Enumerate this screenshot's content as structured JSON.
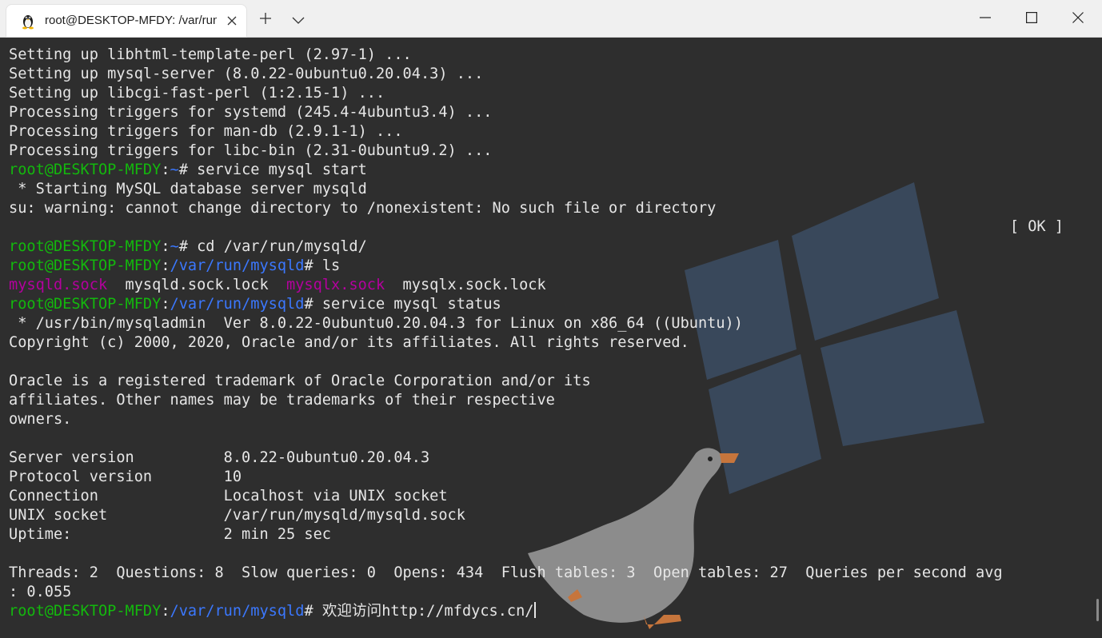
{
  "window": {
    "tab_title": "root@DESKTOP-MFDY: /var/run",
    "tab_icon": "linux-penguin-icon",
    "new_tab_icon": "plus-icon",
    "dropdown_icon": "chevron-down-icon",
    "minimize_icon": "minimize-icon",
    "maximize_icon": "maximize-icon",
    "close_icon": "close-icon"
  },
  "colors": {
    "prompt_user": "#13b80d",
    "prompt_path": "#3b78ff",
    "socket_file": "#b4009e",
    "text": "#e6e6e6",
    "background": "#2e2e2e"
  },
  "terminal": {
    "lines": [
      [
        {
          "t": "Setting up libhtml-template-perl (2.97-1) ...",
          "c": "w"
        }
      ],
      [
        {
          "t": "Setting up mysql-server (8.0.22-0ubuntu0.20.04.3) ...",
          "c": "w"
        }
      ],
      [
        {
          "t": "Setting up libcgi-fast-perl (1:2.15-1) ...",
          "c": "w"
        }
      ],
      [
        {
          "t": "Processing triggers for systemd (245.4-4ubuntu3.4) ...",
          "c": "w"
        }
      ],
      [
        {
          "t": "Processing triggers for man-db (2.9.1-1) ...",
          "c": "w"
        }
      ],
      [
        {
          "t": "Processing triggers for libc-bin (2.31-0ubuntu9.2) ...",
          "c": "w"
        }
      ],
      [
        {
          "t": "root@DESKTOP-MFDY",
          "c": "g"
        },
        {
          "t": ":",
          "c": "w"
        },
        {
          "t": "~",
          "c": "b"
        },
        {
          "t": "# service mysql start",
          "c": "w"
        }
      ],
      [
        {
          "t": " * Starting MySQL database server mysqld",
          "c": "w"
        }
      ],
      [
        {
          "t": "su: warning: cannot change directory to /nonexistent: No such file or directory",
          "c": "w"
        }
      ],
      [
        {
          "t": "",
          "c": "w"
        }
      ],
      [
        {
          "t": "root@DESKTOP-MFDY",
          "c": "g"
        },
        {
          "t": ":",
          "c": "w"
        },
        {
          "t": "~",
          "c": "b"
        },
        {
          "t": "# cd /var/run/mysqld/",
          "c": "w"
        }
      ],
      [
        {
          "t": "root@DESKTOP-MFDY",
          "c": "g"
        },
        {
          "t": ":",
          "c": "w"
        },
        {
          "t": "/var/run/mysqld",
          "c": "b"
        },
        {
          "t": "# ls",
          "c": "w"
        }
      ],
      [
        {
          "t": "mysqld.sock",
          "c": "m"
        },
        {
          "t": "  mysqld.sock.lock  ",
          "c": "w"
        },
        {
          "t": "mysqlx.sock",
          "c": "m"
        },
        {
          "t": "  mysqlx.sock.lock",
          "c": "w"
        }
      ],
      [
        {
          "t": "root@DESKTOP-MFDY",
          "c": "g"
        },
        {
          "t": ":",
          "c": "w"
        },
        {
          "t": "/var/run/mysqld",
          "c": "b"
        },
        {
          "t": "# service mysql status",
          "c": "w"
        }
      ],
      [
        {
          "t": " * /usr/bin/mysqladmin  Ver 8.0.22-0ubuntu0.20.04.3 for Linux on x86_64 ((Ubuntu))",
          "c": "w"
        }
      ],
      [
        {
          "t": "Copyright (c) 2000, 2020, Oracle and/or its affiliates. All rights reserved.",
          "c": "w"
        }
      ],
      [
        {
          "t": "",
          "c": "w"
        }
      ],
      [
        {
          "t": "Oracle is a registered trademark of Oracle Corporation and/or its",
          "c": "w"
        }
      ],
      [
        {
          "t": "affiliates. Other names may be trademarks of their respective",
          "c": "w"
        }
      ],
      [
        {
          "t": "owners.",
          "c": "w"
        }
      ],
      [
        {
          "t": "",
          "c": "w"
        }
      ],
      [
        {
          "t": "Server version          8.0.22-0ubuntu0.20.04.3",
          "c": "w"
        }
      ],
      [
        {
          "t": "Protocol version        10",
          "c": "w"
        }
      ],
      [
        {
          "t": "Connection              Localhost via UNIX socket",
          "c": "w"
        }
      ],
      [
        {
          "t": "UNIX socket             /var/run/mysqld/mysqld.sock",
          "c": "w"
        }
      ],
      [
        {
          "t": "Uptime:                 2 min 25 sec",
          "c": "w"
        }
      ],
      [
        {
          "t": "",
          "c": "w"
        }
      ],
      [
        {
          "t": "Threads: 2  Questions: 8  Slow queries: 0  Opens: 434  Flush tables: 3  Open tables: 27  Queries per second avg",
          "c": "w"
        }
      ],
      [
        {
          "t": ": 0.055",
          "c": "w"
        }
      ],
      [
        {
          "t": "root@DESKTOP-MFDY",
          "c": "g"
        },
        {
          "t": ":",
          "c": "w"
        },
        {
          "t": "/var/run/mysqld",
          "c": "b"
        },
        {
          "t": "# 欢迎访问http://mfdycs.cn/",
          "c": "w"
        }
      ]
    ],
    "status_ok": "[ OK ]"
  }
}
